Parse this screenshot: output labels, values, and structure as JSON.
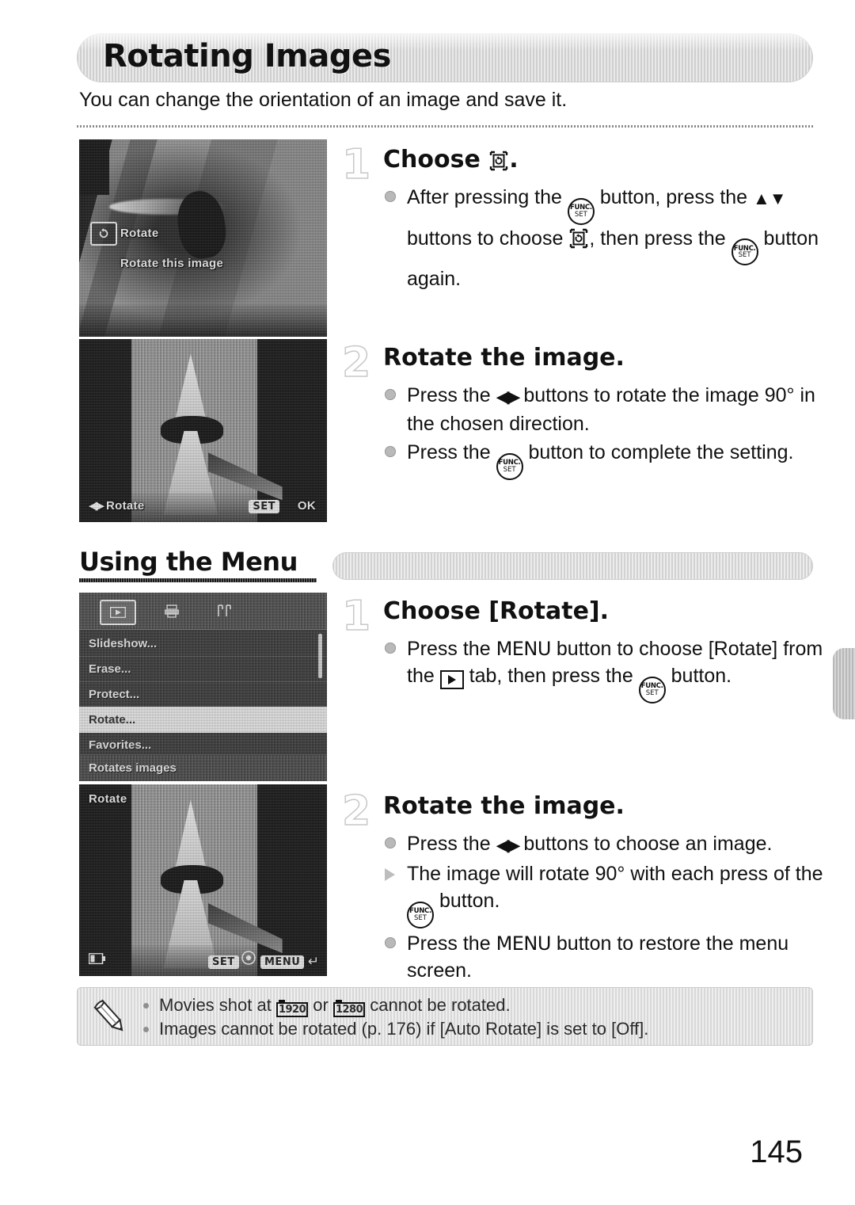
{
  "document": {
    "title": "Rotating Images",
    "intro": "You can change the orientation of an image and save it.",
    "page_number": "145"
  },
  "section_heading": {
    "label": "Using the Menu"
  },
  "steps_func": [
    {
      "number": "1",
      "title_prefix": "Choose ",
      "title_icon": "rotate-icon",
      "title_suffix": ".",
      "bullets": [
        {
          "marker": "dot",
          "parts": [
            {
              "t": "text",
              "v": "After pressing the "
            },
            {
              "t": "icon",
              "v": "func-set-button-icon"
            },
            {
              "t": "text",
              "v": " button, press the "
            },
            {
              "t": "icon",
              "v": "up-down-buttons-icon"
            },
            {
              "t": "text",
              "v": " buttons to choose "
            },
            {
              "t": "icon",
              "v": "rotate-icon"
            },
            {
              "t": "text",
              "v": ", then press the "
            },
            {
              "t": "icon",
              "v": "func-set-button-icon"
            },
            {
              "t": "text",
              "v": " button again."
            }
          ]
        }
      ]
    },
    {
      "number": "2",
      "title_prefix": "Rotate the image.",
      "title_icon": "",
      "title_suffix": "",
      "bullets": [
        {
          "marker": "dot",
          "parts": [
            {
              "t": "text",
              "v": "Press the "
            },
            {
              "t": "icon",
              "v": "left-right-buttons-icon"
            },
            {
              "t": "text",
              "v": " buttons to rotate the image 90° in the chosen direction."
            }
          ]
        },
        {
          "marker": "dot",
          "parts": [
            {
              "t": "text",
              "v": "Press the "
            },
            {
              "t": "icon",
              "v": "func-set-button-icon"
            },
            {
              "t": "text",
              "v": " button to complete the setting."
            }
          ]
        }
      ]
    }
  ],
  "steps_menu": [
    {
      "number": "1",
      "title_prefix": "Choose [Rotate].",
      "title_icon": "",
      "title_suffix": "",
      "bullets": [
        {
          "marker": "dot",
          "parts": [
            {
              "t": "text",
              "v": "Press the "
            },
            {
              "t": "menuword",
              "v": "MENU"
            },
            {
              "t": "text",
              "v": " button to choose [Rotate] from the "
            },
            {
              "t": "icon",
              "v": "playback-tab-icon"
            },
            {
              "t": "text",
              "v": " tab, then press the "
            },
            {
              "t": "icon",
              "v": "func-set-button-icon"
            },
            {
              "t": "text",
              "v": " button."
            }
          ]
        }
      ]
    },
    {
      "number": "2",
      "title_prefix": "Rotate the image.",
      "title_icon": "",
      "title_suffix": "",
      "bullets": [
        {
          "marker": "dot",
          "parts": [
            {
              "t": "text",
              "v": "Press the "
            },
            {
              "t": "icon",
              "v": "left-right-buttons-icon"
            },
            {
              "t": "text",
              "v": " buttons to choose an image."
            }
          ]
        },
        {
          "marker": "tri",
          "parts": [
            {
              "t": "text",
              "v": "The image will rotate 90° with each press of the "
            },
            {
              "t": "icon",
              "v": "func-set-button-icon"
            },
            {
              "t": "text",
              "v": " button."
            }
          ]
        },
        {
          "marker": "dot",
          "parts": [
            {
              "t": "text",
              "v": "Press the "
            },
            {
              "t": "menuword",
              "v": "MENU"
            },
            {
              "t": "text",
              "v": " button to restore the menu screen."
            }
          ]
        }
      ]
    }
  ],
  "screens": {
    "func_overlay": {
      "item_label": "Rotate",
      "item_hint": "Rotate this image"
    },
    "rotate_preview": {
      "left_hint": "Rotate",
      "set_badge": "SET",
      "set_label": "OK"
    },
    "menu": {
      "rows": [
        "Slideshow...",
        "Erase...",
        "Protect...",
        "Rotate...",
        "Favorites..."
      ],
      "selected_row": "Rotate...",
      "footer": "Rotates images"
    },
    "rotate_screen": {
      "title": "Rotate",
      "set_badge": "SET",
      "menu_badge": "MENU"
    }
  },
  "note": {
    "lines": [
      {
        "parts": [
          {
            "t": "text",
            "v": "Movies shot at "
          },
          {
            "t": "res",
            "v": "1920"
          },
          {
            "t": "text",
            "v": " or "
          },
          {
            "t": "res",
            "v": "1280"
          },
          {
            "t": "text",
            "v": " cannot be rotated."
          }
        ]
      },
      {
        "parts": [
          {
            "t": "text",
            "v": "Images cannot be rotated (p. 176) if [Auto Rotate] is set to [Off]."
          }
        ]
      }
    ]
  }
}
